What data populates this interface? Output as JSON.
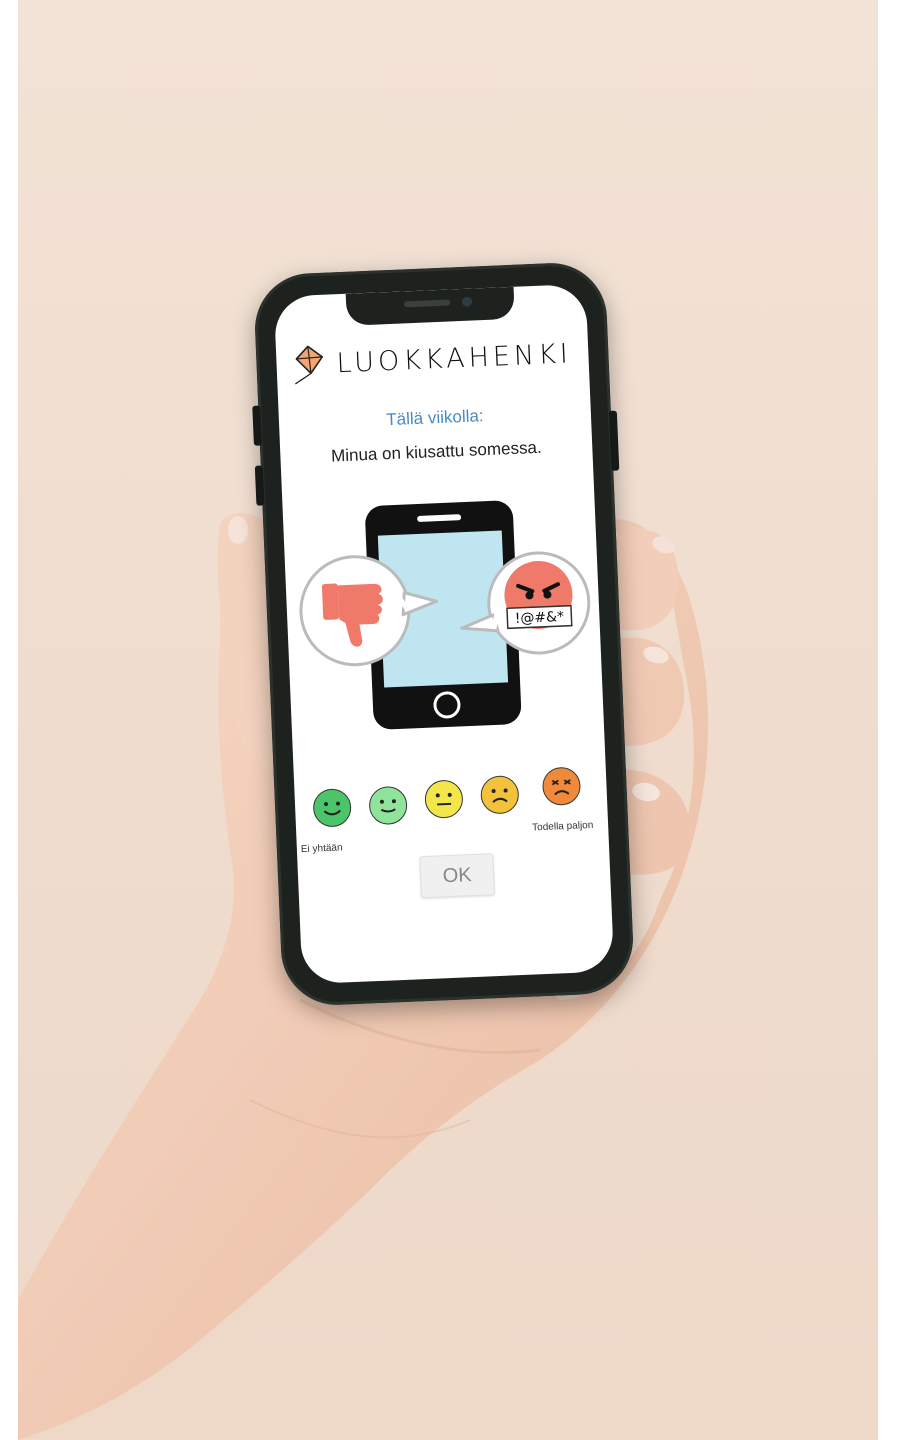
{
  "app": {
    "brand": "LUOKKAHENKI",
    "subtitle": "Tällä viikolla:",
    "question": "Minua on kiusattu somessa."
  },
  "illustration": {
    "speech_text": "!@#&*"
  },
  "scale": {
    "min_label": "Ei yhtään",
    "max_label": "Todella paljon",
    "options": [
      {
        "name": "very-happy",
        "color": "#4cc56a"
      },
      {
        "name": "happy",
        "color": "#8fe39a"
      },
      {
        "name": "neutral",
        "color": "#f2e64a"
      },
      {
        "name": "sad",
        "color": "#f4c23a"
      },
      {
        "name": "angry",
        "color": "#f08a3a"
      }
    ]
  },
  "actions": {
    "ok_label": "OK"
  }
}
